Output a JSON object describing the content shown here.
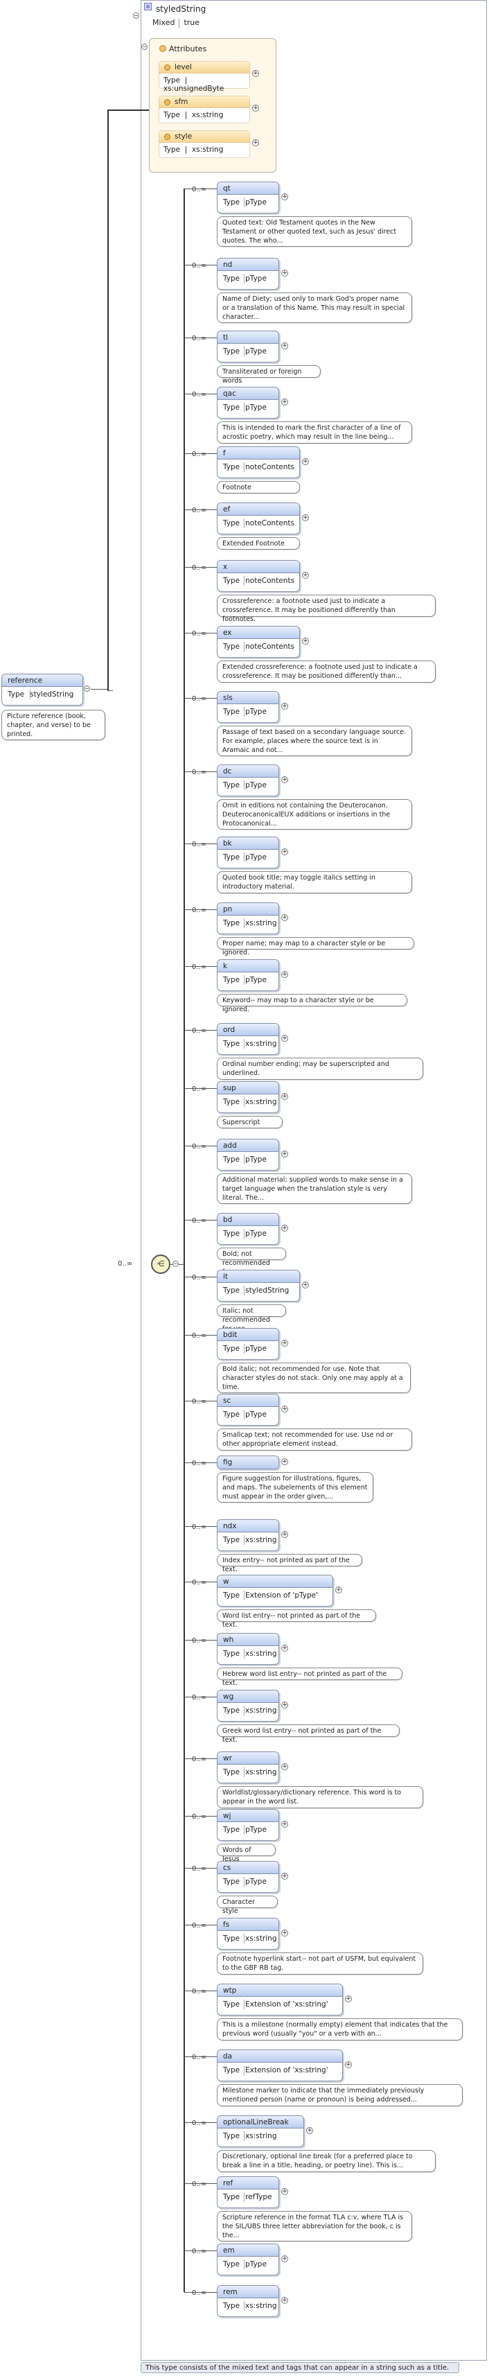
{
  "root": {
    "name": "reference",
    "type_label": "Type",
    "type_value": "styledString",
    "doc": "Picture reference (book, chapter, and verse) to be printed."
  },
  "complex_type": {
    "name": "styledString",
    "mixed_label": "Mixed",
    "mixed_value": "true"
  },
  "attributes": {
    "title": "Attributes",
    "items": [
      {
        "name": "level",
        "type_label": "Type",
        "type_value": "xs:unsignedByte"
      },
      {
        "name": "sfm",
        "type_label": "Type",
        "type_value": "xs:string"
      },
      {
        "name": "style",
        "type_label": "Type",
        "type_value": "xs:string"
      }
    ]
  },
  "choice_occurrence": "0..∞",
  "elements": [
    {
      "occ": "0..∞",
      "name": "qt",
      "type_label": "Type",
      "type_value": "pType",
      "doc": "Quoted text: Old Testament quotes in the New Testament or other quoted text, such as Jesus' direct quotes. The who..."
    },
    {
      "occ": "0..∞",
      "name": "nd",
      "type_label": "Type",
      "type_value": "pType",
      "doc": "Name of Diety; used only to mark God's proper name or a translation of this Name. This may result in special character..."
    },
    {
      "occ": "0..∞",
      "name": "tl",
      "type_label": "Type",
      "type_value": "pType",
      "doc": "Transliterated or foreign words"
    },
    {
      "occ": "0..∞",
      "name": "qac",
      "type_label": "Type",
      "type_value": "pType",
      "doc": "This is intended to mark the first character of a line of acrostic poetry, which may result in the line being..."
    },
    {
      "occ": "0..∞",
      "name": "f",
      "type_label": "Type",
      "type_value": "noteContents",
      "doc": "Footnote"
    },
    {
      "occ": "0..∞",
      "name": "ef",
      "type_label": "Type",
      "type_value": "noteContents",
      "doc": "Extended Footnote"
    },
    {
      "occ": "0..∞",
      "name": "x",
      "type_label": "Type",
      "type_value": "noteContents",
      "doc": "Crossreference: a footnote used just to indicate a crossreference. It may be positioned differently than footnotes."
    },
    {
      "occ": "0..∞",
      "name": "ex",
      "type_label": "Type",
      "type_value": "noteContents",
      "doc": "Extended crossreference: a footnote used just to indicate a crossreference. It may be positioned differently than..."
    },
    {
      "occ": "0..∞",
      "name": "sls",
      "type_label": "Type",
      "type_value": "pType",
      "doc": "Passage of text based on a secondary language source. For example, places where the source text is in Aramaic and not..."
    },
    {
      "occ": "0..∞",
      "name": "dc",
      "type_label": "Type",
      "type_value": "pType",
      "doc": "Omit in editions not containing the Deuterocanon. DeuterocanonicalEUX additions or insertions in the Protocanonical..."
    },
    {
      "occ": "0..∞",
      "name": "bk",
      "type_label": "Type",
      "type_value": "pType",
      "doc": "Quoted book title; may toggle italics setting in introductory material."
    },
    {
      "occ": "0..∞",
      "name": "pn",
      "type_label": "Type",
      "type_value": "xs:string",
      "doc": "Proper name; may map to a character style or be ignored."
    },
    {
      "occ": "0..∞",
      "name": "k",
      "type_label": "Type",
      "type_value": "pType",
      "doc": "Keyword-- may map to a character style or be ignored."
    },
    {
      "occ": "0..∞",
      "name": "ord",
      "type_label": "Type",
      "type_value": "xs:string",
      "doc": "Ordinal number ending; may be superscripted and underlined."
    },
    {
      "occ": "0..∞",
      "name": "sup",
      "type_label": "Type",
      "type_value": "xs:string",
      "doc": "Superscript"
    },
    {
      "occ": "0..∞",
      "name": "add",
      "type_label": "Type",
      "type_value": "pType",
      "doc": "Additional material; supplied words to make sense in a target language when the translation style is very literal. The..."
    },
    {
      "occ": "0..∞",
      "name": "bd",
      "type_label": "Type",
      "type_value": "pType",
      "doc": "Bold; not recommended for use."
    },
    {
      "occ": "0..∞",
      "name": "it",
      "type_label": "Type",
      "type_value": "styledString",
      "doc": "Italic; not recommended for use."
    },
    {
      "occ": "0..∞",
      "name": "bdit",
      "type_label": "Type",
      "type_value": "pType",
      "doc": "Bold italic; not recommended for use. Note that character styles do not stack. Only one may apply at a time."
    },
    {
      "occ": "0..∞",
      "name": "sc",
      "type_label": "Type",
      "type_value": "pType",
      "doc": "Smallcap text; not recommended for use. Use nd or other appropriate element instead."
    },
    {
      "occ": "0..∞",
      "name": "fig",
      "type_label": "",
      "type_value": "",
      "doc": "Figure suggestion for illustrations, figures, and maps. The subelements of this element must appear in the order given,..."
    },
    {
      "occ": "0..∞",
      "name": "ndx",
      "type_label": "Type",
      "type_value": "xs:string",
      "doc": "Index entry-- not printed as part of the text."
    },
    {
      "occ": "0..∞",
      "name": "w",
      "type_label": "Type",
      "type_value": "Extension of 'pType'",
      "doc": "Word list entry-- not printed as part of the text."
    },
    {
      "occ": "0..∞",
      "name": "wh",
      "type_label": "Type",
      "type_value": "xs:string",
      "doc": "Hebrew word list entry-- not printed as part of the text."
    },
    {
      "occ": "0..∞",
      "name": "wg",
      "type_label": "Type",
      "type_value": "xs:string",
      "doc": "Greek word list entry-- not printed as part of the text."
    },
    {
      "occ": "0..∞",
      "name": "wr",
      "type_label": "Type",
      "type_value": "xs:string",
      "doc": "Worldlist/glossary/dictionary reference. This word is to appear in the word list."
    },
    {
      "occ": "0..∞",
      "name": "wj",
      "type_label": "Type",
      "type_value": "pType",
      "doc": "Words of Jesus"
    },
    {
      "occ": "0..∞",
      "name": "cs",
      "type_label": "Type",
      "type_value": "pType",
      "doc": "Character style"
    },
    {
      "occ": "0..∞",
      "name": "fs",
      "type_label": "Type",
      "type_value": "xs:string",
      "doc": "Footnote hyperlink start-- not part of USFM, but equivalent to the GBF RB tag."
    },
    {
      "occ": "0..∞",
      "name": "wtp",
      "type_label": "Type",
      "type_value": "Extension of 'xs:string'",
      "doc": "This is a milestone (normally empty) element that indicates that the previous word (usually \"you\" or a verb with an..."
    },
    {
      "occ": "0..∞",
      "name": "da",
      "type_label": "Type",
      "type_value": "Extension of 'xs:string'",
      "doc": "Milestone marker to indicate that the immediately previously mentioned person (name or pronoun) is being addressed..."
    },
    {
      "occ": "0..∞",
      "name": "optionalLineBreak",
      "type_label": "Type",
      "type_value": "xs:string",
      "doc": "Discretionary, optional line break (for a preferred place to break a line in a title, heading, or poetry line). This is..."
    },
    {
      "occ": "0..∞",
      "name": "ref",
      "type_label": "Type",
      "type_value": "refType",
      "doc": "Scripture reference in the format TLA c:v, where TLA is the SIL/UBS three letter abbreviation for the book, c is the..."
    },
    {
      "occ": "0..∞",
      "name": "em",
      "type_label": "Type",
      "type_value": "pType",
      "doc": ""
    },
    {
      "occ": "0..∞",
      "name": "rem",
      "type_label": "Type",
      "type_value": "xs:string",
      "doc": ""
    }
  ],
  "footer": "This type consists of the mixed text and tags that can appear in a string such as a title."
}
